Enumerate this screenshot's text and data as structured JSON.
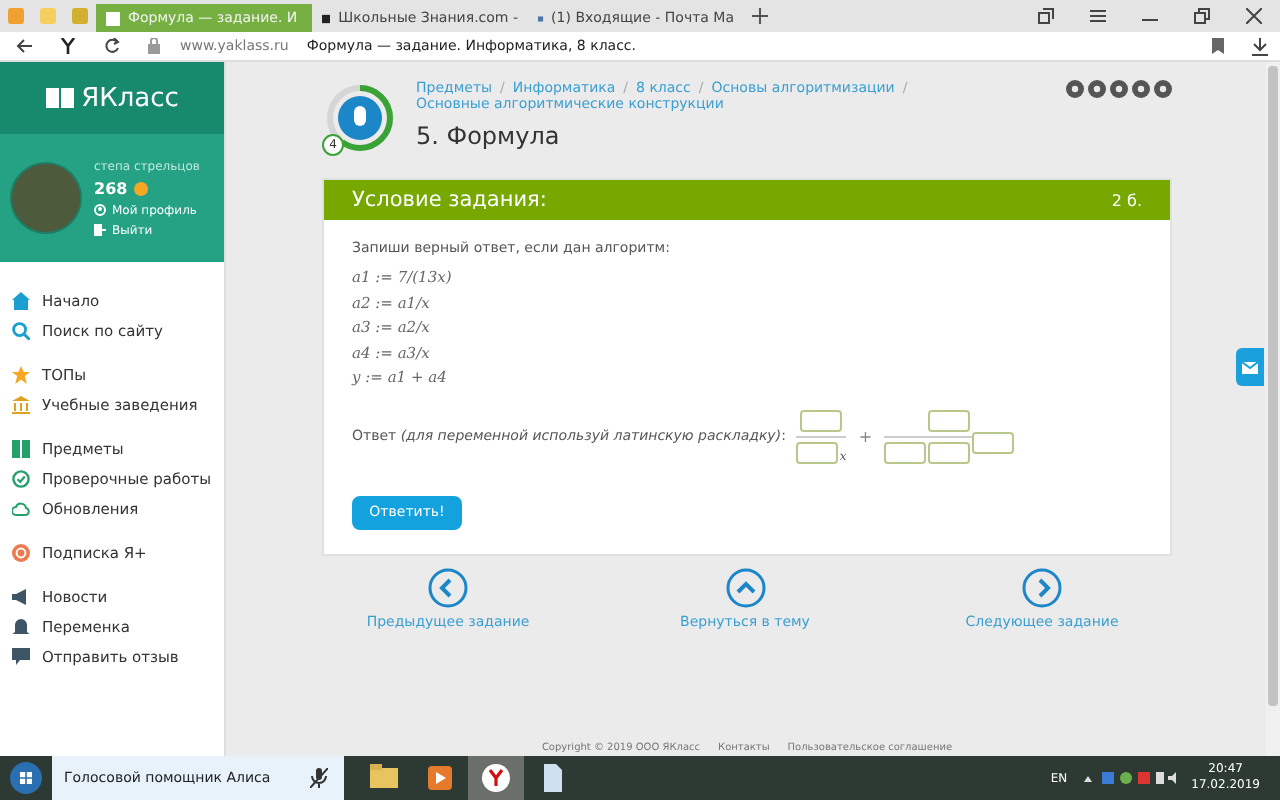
{
  "browser": {
    "tabs": [
      {
        "label": "Формула — задание. И",
        "selected": true
      },
      {
        "label": "Школьные Знания.com -",
        "selected": false
      },
      {
        "label": "(1) Входящие - Почта Ma",
        "selected": false
      }
    ],
    "domain": "www.yaklass.ru",
    "page_title": "Формула — задание. Информатика, 8 класс."
  },
  "sidebar": {
    "logo": "ЯКласс",
    "user": {
      "name": "степа стрельцов",
      "points": "268",
      "links": [
        "Мой профиль",
        "Выйти"
      ]
    },
    "groups": [
      [
        "Начало",
        "Поиск по сайту"
      ],
      [
        "ТОПы",
        "Учебные заведения"
      ],
      [
        "Предметы",
        "Проверочные работы",
        "Обновления"
      ],
      [
        "Подписка Я+"
      ],
      [
        "Новости",
        "Переменка",
        "Отправить отзыв"
      ]
    ]
  },
  "topic": {
    "badge": "4",
    "level": 0.6,
    "separators": [
      "/",
      "/",
      "/",
      "/"
    ],
    "breadcrumbs": [
      "Предметы",
      "Информатика",
      "8 класс",
      "Основы алгоритмизации",
      "Основные алгоритмические конструкции"
    ],
    "title": "5. Формула"
  },
  "card": {
    "header": "Условие задания:",
    "points": "2 б.",
    "prompt": "Запиши верный ответ, если дан алгоритм:",
    "lines": [
      "a1 := 7/(13x)",
      "a2 := a1/x",
      "a3 := a2/x",
      "a4 := a3/x",
      "y := a1 + a4"
    ],
    "answer": {
      "label": "Ответ *(для переменной используй латинскую раскладку)*:",
      "variable": "x",
      "operator": "+"
    },
    "button": "Ответить!"
  },
  "nav": [
    "Предыдущее задание",
    "Вернуться в тему",
    "Следующее задание"
  ],
  "footer": [
    "Copyright © 2019 ООО ЯКласс",
    "Контакты",
    "Пользовательское соглашение"
  ],
  "taskbar": {
    "search": {
      "placeholder": "Голосовой помощник Алиса"
    },
    "language": "EN",
    "time": "20:47",
    "date": "17.02.2019"
  }
}
